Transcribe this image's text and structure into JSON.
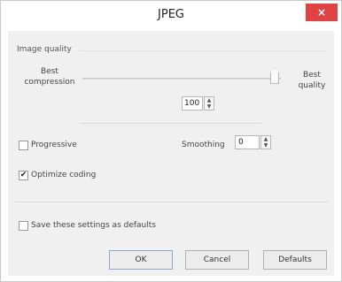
{
  "window": {
    "title": "JPEG",
    "close_label": "×"
  },
  "image_quality": {
    "group_label": "Image quality",
    "left_label": "Best compression",
    "right_label": "Best quality",
    "value": "100",
    "slider_level": 1.0
  },
  "options": {
    "progressive": {
      "label": "Progressive",
      "checked": false
    },
    "optimize_coding": {
      "label": "Optimize coding",
      "checked": true,
      "check_glyph": "✔"
    },
    "smoothing": {
      "label": "Smoothing",
      "value": "0"
    }
  },
  "defaults_checkbox": {
    "label": "Save these settings as defaults",
    "checked": false
  },
  "buttons": {
    "ok": "OK",
    "cancel": "Cancel",
    "defaults": "Defaults"
  },
  "spinner": {
    "up": "▲",
    "down": "▼"
  },
  "colors": {
    "close_bg": "#e04343",
    "client_bg": "#f0f0f0",
    "ok_border": "#8ca6cf"
  }
}
